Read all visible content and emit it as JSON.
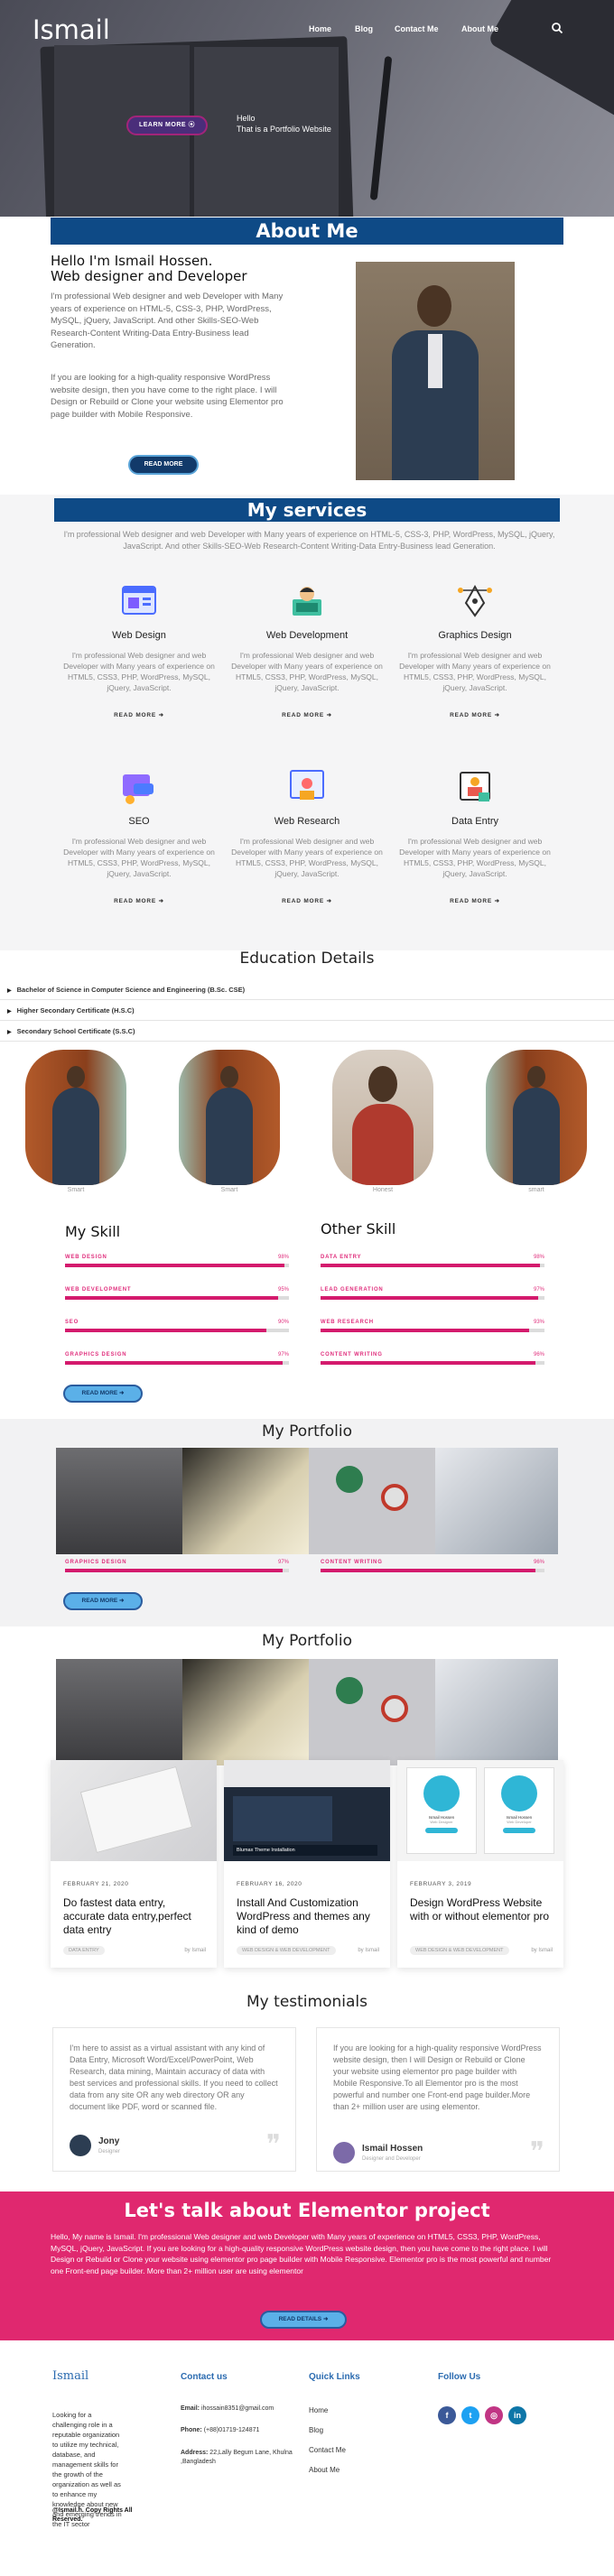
{
  "header": {
    "logo": "Ismail",
    "nav": [
      "Home",
      "Blog",
      "Contact Me",
      "About Me"
    ]
  },
  "hero": {
    "button": "LEARN MORE",
    "line1": "Hello",
    "line2": "That is a Portfolio Website"
  },
  "about": {
    "title": "About Me",
    "heading1": "Hello I'm Ismail Hossen.",
    "heading2": "Web designer and Developer",
    "p1": "I'm professional Web designer and web Developer with Many years of experience on HTML-5, CSS-3, PHP, WordPress, MySQL, jQuery, JavaScript. And other Skills-SEO-Web Research-Content Writing-Data Entry-Business lead Generation.",
    "p2": "If you are looking for a high-quality responsive WordPress website design, then you have come to the right place. I will Design or Rebuild or Clone your website using Elementor pro page builder with Mobile Responsive.",
    "button": "READ MORE"
  },
  "services": {
    "title": "My services",
    "intro": "I'm professional Web designer and web Developer with Many years of experience on HTML-5, CSS-3, PHP, WordPress, MySQL, jQuery, JavaScript. And other Skills-SEO-Web Research-Content Writing-Data Entry-Business lead Generation.",
    "desc": "I'm professional Web designer and web Developer with Many years of experience on HTML5, CSS3, PHP, WordPress, MySQL, jQuery, JavaScript.",
    "read_more": "READ MORE",
    "items": [
      {
        "title": "Web Design",
        "icon": "web-design-icon"
      },
      {
        "title": "Web Development",
        "icon": "web-development-icon"
      },
      {
        "title": "Graphics Design",
        "icon": "graphics-design-icon"
      },
      {
        "title": "SEO",
        "icon": "seo-icon"
      },
      {
        "title": "Web Research",
        "icon": "web-research-icon"
      },
      {
        "title": "Data Entry",
        "icon": "data-entry-icon"
      }
    ]
  },
  "education": {
    "title": "Education Details",
    "items": [
      "Bachelor of Science in Computer Science and Engineering (B.Sc. CSE)",
      "Higher Secondary Certificate (H.S.C)",
      "Secondary School Certificate (S.S.C)"
    ]
  },
  "team": [
    "Smart",
    "Smart",
    "Honest",
    "smart"
  ],
  "skills": {
    "left_title": "My Skill",
    "right_title": "Other Skill",
    "left": [
      {
        "name": "WEB DESIGN",
        "value": 98
      },
      {
        "name": "WEB DEVELOPMENT",
        "value": 95
      },
      {
        "name": "SEO",
        "value": 90
      },
      {
        "name": "GRAPHICS DESIGN",
        "value": 97
      }
    ],
    "right": [
      {
        "name": "DATA ENTRY",
        "value": 98
      },
      {
        "name": "LEAD GENERATION",
        "value": 97
      },
      {
        "name": "WEB RESEARCH",
        "value": 93
      },
      {
        "name": "CONTENT WRITING",
        "value": 96
      }
    ],
    "button": "READ MORE"
  },
  "portfolio1": {
    "title": "My Portfolio",
    "skills": [
      {
        "name": "GRAPHICS DESIGN",
        "value": 97
      },
      {
        "name": "CONTENT WRITING",
        "value": 96
      }
    ],
    "button": "READ MORE"
  },
  "portfolio2": {
    "title": "My Portfolio"
  },
  "blog": [
    {
      "date": "FEBRUARY 21, 2020",
      "title": "Do fastest data entry, accurate data entry,perfect data entry",
      "tag": "DATA ENTRY",
      "by": "by Ismail"
    },
    {
      "date": "FEBRUARY 16, 2020",
      "title": "Install And Customization WordPress and themes any kind of demo",
      "tag": "WEB DESIGN & WEB DEVELOPMENT",
      "by": "by Ismail",
      "screen_text": "Blumax   Theme Installation"
    },
    {
      "date": "FEBRUARY 3, 2019",
      "title": "Design WordPress Website with or without elementor pro",
      "tag": "WEB DESIGN & WEB DEVELOPMENT",
      "by": "by Ismail",
      "names": [
        "Ismail Hossen",
        "Ismail Hossen"
      ],
      "roles": [
        "Web Designer",
        "Web Developer"
      ]
    }
  ],
  "testimonials": {
    "title": "My testimonials",
    "items": [
      {
        "quote": "I'm here to assist as a virtual assistant with any kind of Data Entry, Microsoft Word/Excel/PowerPoint, Web Research, data mining, Maintain accuracy of data with best services and professional skills. If you need to collect data from any site OR any web directory OR any document like PDF, word or scanned file.",
        "name": "Jony",
        "role": "Designer"
      },
      {
        "quote": "If you are looking for a high-quality responsive WordPress website design, then I will Design or Rebuild or Clone your website using elementor pro page builder with Mobile Responsive.To all Elementor pro is the most powerful and number one Front-end page builder.More than 2+ million user are using elementor.",
        "name": "Ismail Hossen",
        "role": "Designer and Developer"
      }
    ]
  },
  "cta": {
    "title": "Let's talk about Elementor project",
    "text": "Hello, My name is Ismail. I'm professional Web designer and web Developer with Many years of experience on HTML5, CSS3, PHP, WordPress, MySQL, jQuery, JavaScript. If you are looking for a high-quality responsive WordPress website design, then you have come to the right place. I will Design or Rebuild or Clone your website using elementor pro page builder with Mobile Responsive. Elementor pro is the most powerful and number one Front-end page builder. More than 2+ million user are using elementor",
    "button": "READ DETAILS"
  },
  "footer": {
    "logo": "Ismail",
    "about": "Looking for a challenging role in a reputable organization to utilize my technical, database, and management skills for the growth of the organization as well as to enhance my knowledge about new and emerging trends in the IT sector",
    "copyright": "@Ismail.h. Copy Rights All Reserved.",
    "contact_title": "Contact us",
    "email_label": "Email:",
    "email": "ihossain8351@gmail.com",
    "phone_label": "Phone:",
    "phone": "(+88)01719-124871",
    "address_label": "Address:",
    "address": "22,Lally Begum Lane, Khulna ,Bangladesh",
    "links_title": "Quick Links",
    "links": [
      "Home",
      "Blog",
      "Contact Me",
      "About Me"
    ],
    "follow_title": "Follow Us",
    "social": [
      {
        "icon": "facebook-icon",
        "glyph": "f",
        "color": "#3b5998"
      },
      {
        "icon": "twitter-icon",
        "glyph": "t",
        "color": "#1da1f2"
      },
      {
        "icon": "instagram-icon",
        "glyph": "◎",
        "color": "#c13584"
      },
      {
        "icon": "linkedin-icon",
        "glyph": "in",
        "color": "#0e76a8"
      }
    ]
  },
  "colors": {
    "primary": "#0e4a86",
    "accent": "#d41a6d",
    "cta": "#e0286f",
    "button_blue": "#5bb0e8"
  }
}
